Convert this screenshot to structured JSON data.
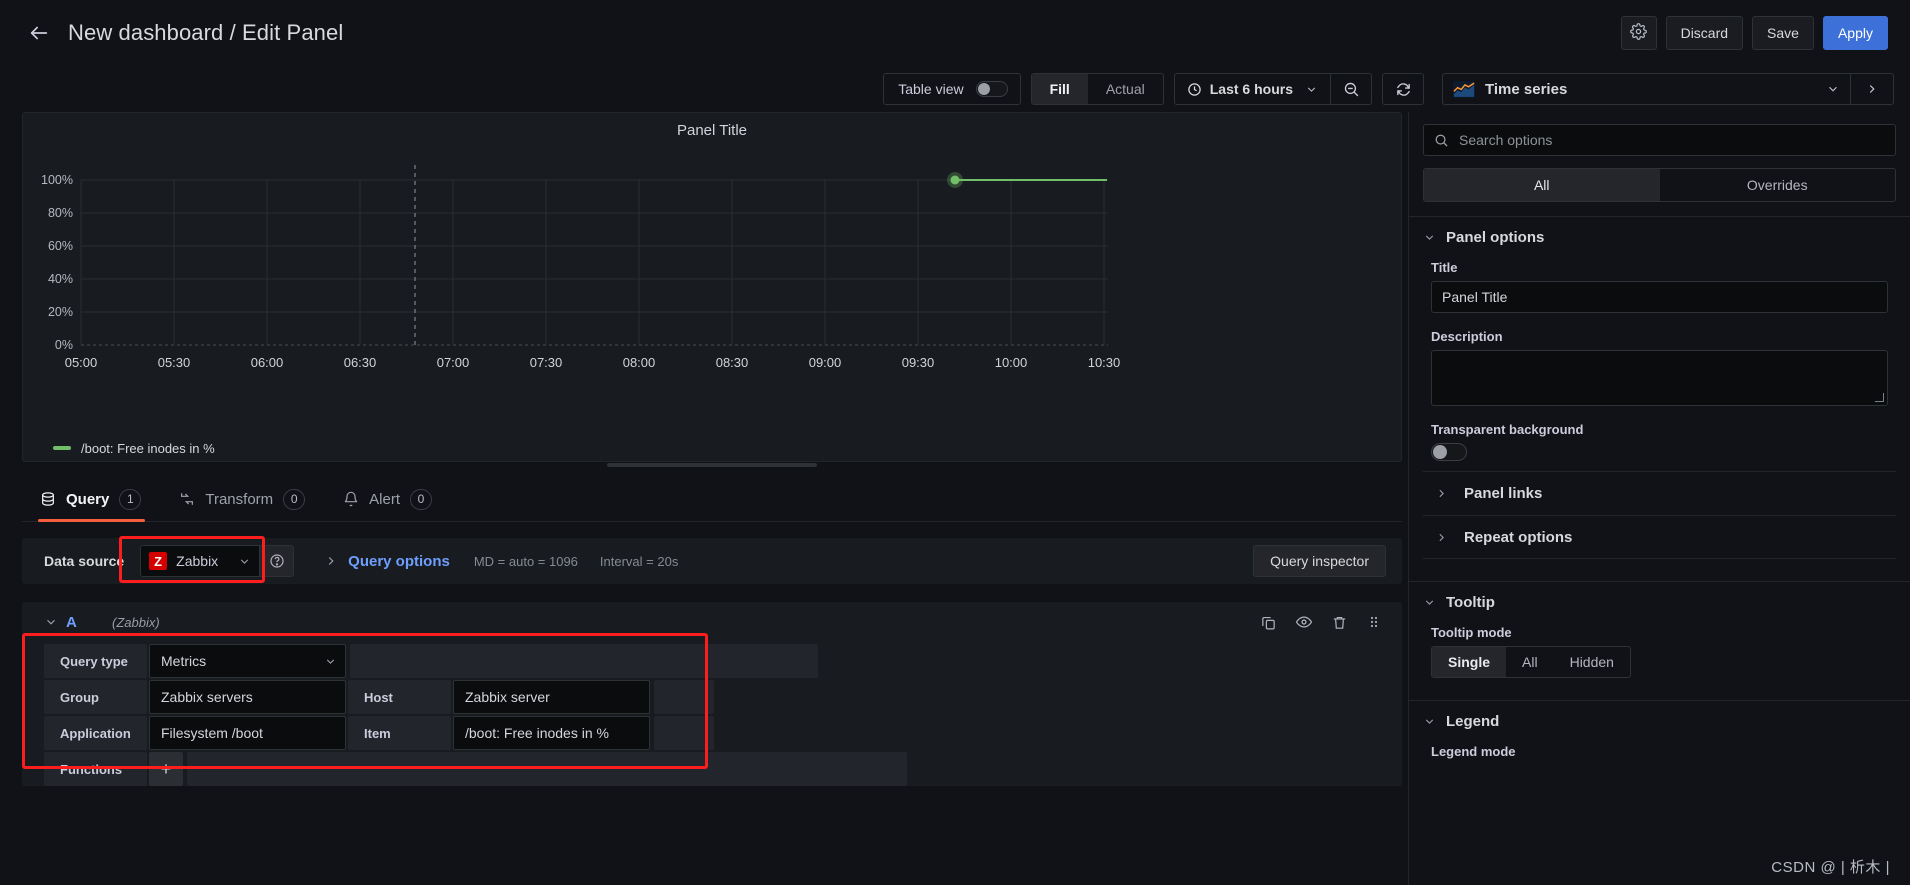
{
  "header": {
    "back_icon": "arrow-left-icon",
    "title": "New dashboard / Edit Panel",
    "gear_icon": "gear-icon",
    "discard_label": "Discard",
    "save_label": "Save",
    "apply_label": "Apply",
    "accent_primary": "#3d71d9"
  },
  "toolbar": {
    "table_view_label": "Table view",
    "table_view_on": false,
    "fill_label": "Fill",
    "actual_label": "Actual",
    "fill_actual_selected": "Fill",
    "clock_icon": "clock-icon",
    "time_range": "Last 6 hours",
    "zoom_out_icon": "zoom-out-icon",
    "refresh_icon": "refresh-icon",
    "viz_icon": "time-series-icon",
    "viz_name": "Time series",
    "viz_chevron_icon": "chevron-down-icon",
    "viz_next_icon": "chevron-right-icon"
  },
  "panel": {
    "title": "Panel Title",
    "legend_label": "/boot: Free inodes in %",
    "legend_color": "#73bf69"
  },
  "chart_data": {
    "type": "line",
    "title": "Panel Title",
    "xlabel": "",
    "ylabel": "",
    "ylim": [
      0,
      100
    ],
    "y_ticks": [
      "0%",
      "20%",
      "40%",
      "60%",
      "80%",
      "100%"
    ],
    "y_tick_values": [
      0,
      20,
      40,
      60,
      80,
      100
    ],
    "x_ticks": [
      "05:00",
      "05:30",
      "06:00",
      "06:30",
      "07:00",
      "07:30",
      "08:00",
      "08:30",
      "09:00",
      "09:30",
      "10:00",
      "10:30"
    ],
    "grid": true,
    "legend": [
      "/boot: Free inodes in %"
    ],
    "legend_position": "bottom",
    "series": [
      {
        "name": "/boot: Free inodes in %",
        "color": "#73bf69",
        "points": [
          {
            "x": "09:51",
            "y": 100
          },
          {
            "x": "10:45",
            "y": 100
          }
        ]
      }
    ],
    "annotations": [
      "dashed vertical cursor line near 06:50"
    ]
  },
  "query_tabs": [
    {
      "label": "Query",
      "badge": "1",
      "icon": "database-icon",
      "active": true
    },
    {
      "label": "Transform",
      "badge": "0",
      "icon": "transform-icon",
      "active": false
    },
    {
      "label": "Alert",
      "badge": "0",
      "icon": "bell-icon",
      "active": false
    }
  ],
  "datasource_row": {
    "label": "Data source",
    "logo_text": "Z",
    "name": "Zabbix",
    "chevron_icon": "chevron-down-icon",
    "help_icon": "help-circle-icon",
    "expand_icon": "chevron-right-icon",
    "query_options_label": "Query options",
    "md_text": "MD = auto = 1096",
    "interval_text": "Interval = 20s",
    "query_inspector_label": "Query inspector",
    "highlight_color": "#fc1d1d"
  },
  "query_row": {
    "chevron_icon": "chevron-down-icon",
    "letter": "A",
    "datasource": "(Zabbix)",
    "icons": [
      "copy-icon",
      "eye-icon",
      "trash-icon",
      "drag-handle-icon"
    ]
  },
  "query_form": {
    "rows": [
      {
        "label": "Query type",
        "value": "Metrics",
        "has_caret": true
      },
      {
        "label": "Group",
        "value": "Zabbix servers",
        "label2": "Host",
        "value2": "Zabbix server"
      },
      {
        "label": "Application",
        "value": "Filesystem /boot",
        "label2": "Item",
        "value2": "/boot: Free inodes in %"
      }
    ],
    "functions_label": "Functions",
    "add_function_icon": "plus-icon"
  },
  "options_pane": {
    "search_placeholder": "Search options",
    "search_icon": "search-icon",
    "search_value": "",
    "tabs": [
      {
        "label": "All",
        "active": true
      },
      {
        "label": "Overrides",
        "active": false
      }
    ],
    "sections": [
      {
        "title": "Panel options",
        "title_field_label": "Title",
        "title_field_value": "Panel Title",
        "description_label": "Description",
        "description_value": "",
        "transparent_label": "Transparent background",
        "transparent_on": false,
        "sub_items": [
          "Panel links",
          "Repeat options"
        ]
      },
      {
        "title": "Tooltip",
        "mode_label": "Tooltip mode",
        "modes": [
          "Single",
          "All",
          "Hidden"
        ],
        "mode_selected": "Single"
      },
      {
        "title": "Legend",
        "mode_label": "Legend mode"
      }
    ]
  },
  "watermark": "CSDN @ | 析木 |"
}
